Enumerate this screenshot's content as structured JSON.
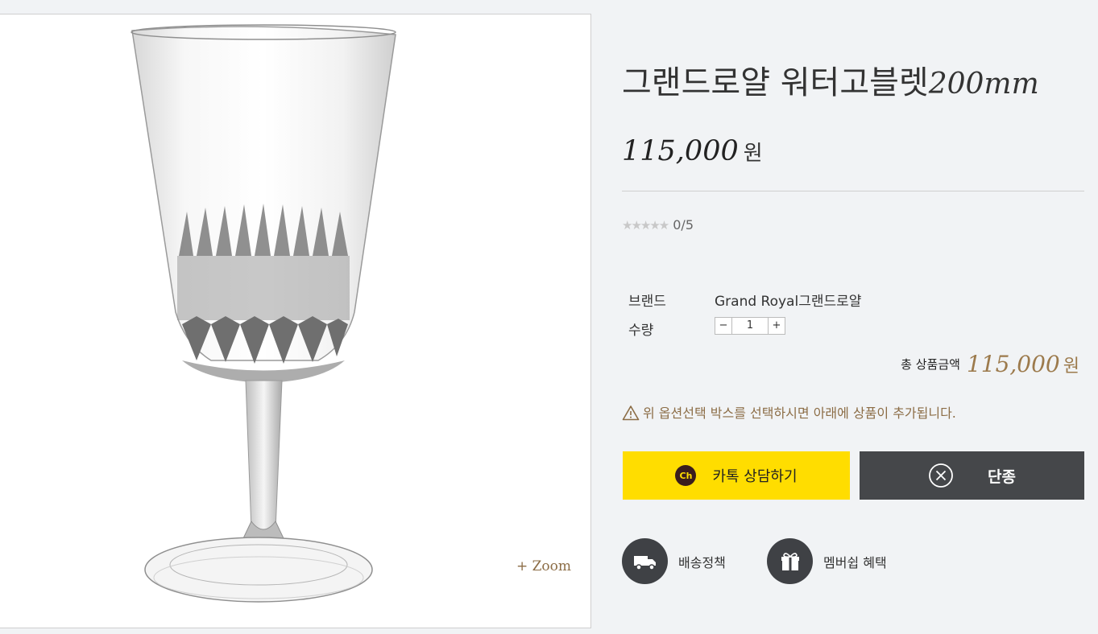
{
  "product": {
    "title": "그랜드로얄 워터고블렛",
    "size": "200mm",
    "price": "115,000",
    "currency": "원"
  },
  "gallery": {
    "zoom_label": "+ Zoom"
  },
  "rating": {
    "stars": "★★★★★",
    "score": "0/5"
  },
  "specs": {
    "brand_label": "브랜드",
    "brand_value": "Grand Royal그랜드로얄",
    "qty_label": "수량",
    "qty_value": "1",
    "minus": "−",
    "plus": "+"
  },
  "total": {
    "label": "총 상품금액",
    "amount": "115,000",
    "unit": "원"
  },
  "notice": "위 옵션선택 박스를 선택하시면 아래에 상품이 추가됩니다.",
  "buttons": {
    "kakao_icon": "Ch",
    "kakao_label": "카톡 상담하기",
    "discontinued_label": "단종"
  },
  "links": {
    "shipping_label": "배송정책",
    "membership_label": "멤버쉽 혜택"
  },
  "colors": {
    "kakao": "#ffdd00",
    "dark_button": "#45474a",
    "accent_gold": "#9c7a4c"
  }
}
